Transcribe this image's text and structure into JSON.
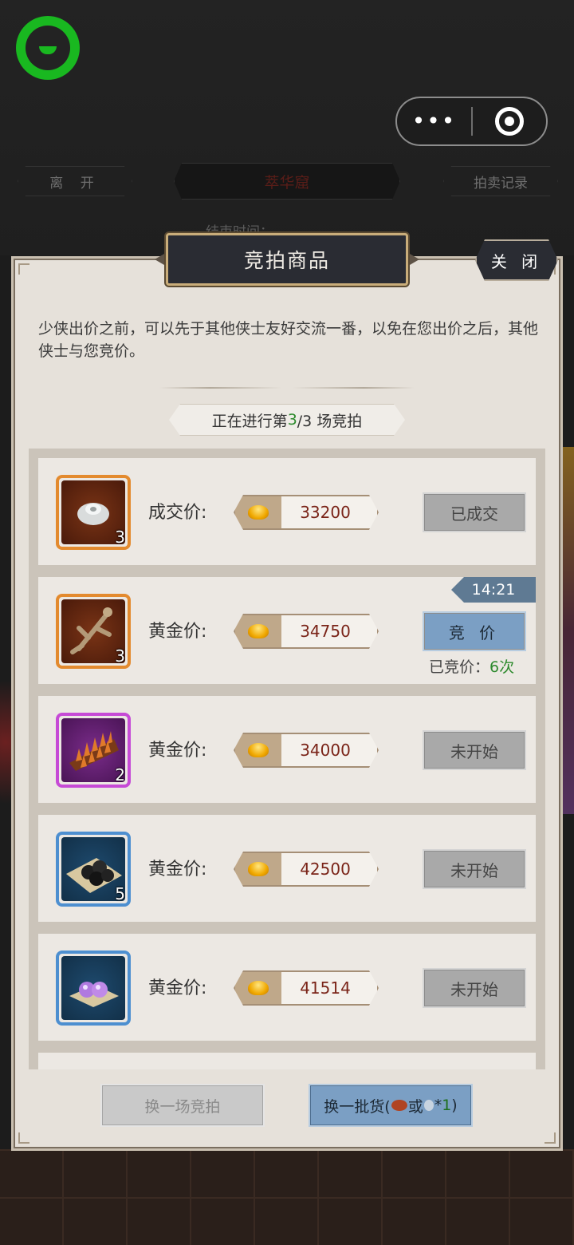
{
  "header": {
    "leave_label": "离 开",
    "title": "萃华窟",
    "records_label": "拍卖记录",
    "end_time_label": "结束时间：",
    "capsule_more": "•••"
  },
  "panel": {
    "title": "竞拍商品",
    "close_label": "关 闭",
    "intro": "少侠出价之前，可以先于其他侠士友好交流一番，以免在您出价之后，其他侠士与您竞价。",
    "round": {
      "prefix": "正在进行第 ",
      "current": "3",
      "suffix": "/3 场竞拍"
    }
  },
  "items": [
    {
      "price_label": "成交价:",
      "price": "33200",
      "quantity": "3",
      "state": "已成交",
      "quality": "orange",
      "icon": "silver-ornament-icon"
    },
    {
      "price_label": "黄金价:",
      "price": "34750",
      "quantity": "3",
      "state": "竞 价",
      "timer": "14:21",
      "bid_label": "已竞价：",
      "bid_count": "6次",
      "quality": "orange",
      "icon": "bronze-figure-icon"
    },
    {
      "price_label": "黄金价:",
      "price": "34000",
      "quantity": "2",
      "state": "未开始",
      "quality": "purple",
      "icon": "spiked-weapon-icon"
    },
    {
      "price_label": "黄金价:",
      "price": "42500",
      "quantity": "5",
      "state": "未开始",
      "quality": "blue",
      "icon": "black-pearls-icon"
    },
    {
      "price_label": "黄金价:",
      "price": "41514",
      "quantity": "",
      "state": "未开始",
      "quality": "blue",
      "icon": "purple-pearls-icon"
    }
  ],
  "footer": {
    "switch_label": "换一场竞拍",
    "refresh_prefix": "换一批货(",
    "refresh_or": "或",
    "refresh_star": "*",
    "refresh_count": "1",
    "refresh_suffix": ")"
  },
  "colors": {
    "accent_blue": "#7b9fc4",
    "price_text": "#7a2418",
    "highlight_green": "#2d8a2d",
    "panel_bg": "#e6e1da"
  }
}
